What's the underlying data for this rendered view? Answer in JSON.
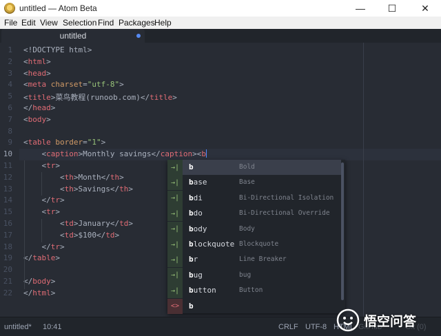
{
  "window": {
    "title": "untitled — Atom Beta",
    "controls": {
      "minimize": "—",
      "maximize": "☐",
      "close": "✕"
    }
  },
  "menu": [
    "File",
    "Edit",
    "View",
    "Selection",
    "Find",
    "Packages",
    "Help"
  ],
  "tab": {
    "label": "untitled",
    "modified": true
  },
  "editor": {
    "active_line": 10,
    "lines": [
      [
        {
          "t": "<!DOCTYPE html>",
          "c": "text"
        }
      ],
      [
        {
          "t": "<",
          "c": "punct"
        },
        {
          "t": "html",
          "c": "tag"
        },
        {
          "t": ">",
          "c": "punct"
        }
      ],
      [
        {
          "t": "<",
          "c": "punct"
        },
        {
          "t": "head",
          "c": "tag"
        },
        {
          "t": ">",
          "c": "punct"
        }
      ],
      [
        {
          "t": "<",
          "c": "punct"
        },
        {
          "t": "meta",
          "c": "tag"
        },
        {
          "t": " ",
          "c": "text"
        },
        {
          "t": "charset",
          "c": "attr"
        },
        {
          "t": "=",
          "c": "punct"
        },
        {
          "t": "\"utf-8\"",
          "c": "str"
        },
        {
          "t": ">",
          "c": "punct"
        }
      ],
      [
        {
          "t": "<",
          "c": "punct"
        },
        {
          "t": "title",
          "c": "tag"
        },
        {
          "t": ">菜鸟教程(runoob.com)</",
          "c": "text"
        },
        {
          "t": "title",
          "c": "tag"
        },
        {
          "t": ">",
          "c": "punct"
        }
      ],
      [
        {
          "t": "</",
          "c": "punct"
        },
        {
          "t": "head",
          "c": "tag"
        },
        {
          "t": ">",
          "c": "punct"
        }
      ],
      [
        {
          "t": "<",
          "c": "punct"
        },
        {
          "t": "body",
          "c": "tag"
        },
        {
          "t": ">",
          "c": "punct"
        }
      ],
      [],
      [
        {
          "t": "<",
          "c": "punct"
        },
        {
          "t": "table",
          "c": "tag"
        },
        {
          "t": " ",
          "c": "text"
        },
        {
          "t": "border",
          "c": "attr"
        },
        {
          "t": "=",
          "c": "punct"
        },
        {
          "t": "\"1\"",
          "c": "str"
        },
        {
          "t": ">",
          "c": "punct"
        }
      ],
      [
        {
          "t": "    <",
          "c": "punct"
        },
        {
          "t": "caption",
          "c": "tag"
        },
        {
          "t": ">Monthly savings</",
          "c": "text"
        },
        {
          "t": "caption",
          "c": "tag"
        },
        {
          "t": "><",
          "c": "punct"
        },
        {
          "t": "b",
          "c": "tag"
        }
      ],
      [
        {
          "t": "    <",
          "c": "punct"
        },
        {
          "t": "tr",
          "c": "tag"
        },
        {
          "t": ">",
          "c": "punct"
        }
      ],
      [
        {
          "t": "        <",
          "c": "punct"
        },
        {
          "t": "th",
          "c": "tag"
        },
        {
          "t": ">Month</",
          "c": "text"
        },
        {
          "t": "th",
          "c": "tag"
        },
        {
          "t": ">",
          "c": "punct"
        }
      ],
      [
        {
          "t": "        <",
          "c": "punct"
        },
        {
          "t": "th",
          "c": "tag"
        },
        {
          "t": ">Savings</",
          "c": "text"
        },
        {
          "t": "th",
          "c": "tag"
        },
        {
          "t": ">",
          "c": "punct"
        }
      ],
      [
        {
          "t": "    </",
          "c": "punct"
        },
        {
          "t": "tr",
          "c": "tag"
        },
        {
          "t": ">",
          "c": "punct"
        }
      ],
      [
        {
          "t": "    <",
          "c": "punct"
        },
        {
          "t": "tr",
          "c": "tag"
        },
        {
          "t": ">",
          "c": "punct"
        }
      ],
      [
        {
          "t": "        <",
          "c": "punct"
        },
        {
          "t": "td",
          "c": "tag"
        },
        {
          "t": ">January</",
          "c": "text"
        },
        {
          "t": "td",
          "c": "tag"
        },
        {
          "t": ">",
          "c": "punct"
        }
      ],
      [
        {
          "t": "        <",
          "c": "punct"
        },
        {
          "t": "td",
          "c": "tag"
        },
        {
          "t": ">$100</",
          "c": "text"
        },
        {
          "t": "td",
          "c": "tag"
        },
        {
          "t": ">",
          "c": "punct"
        }
      ],
      [
        {
          "t": "    </",
          "c": "punct"
        },
        {
          "t": "tr",
          "c": "tag"
        },
        {
          "t": ">",
          "c": "punct"
        }
      ],
      [
        {
          "t": "</",
          "c": "punct"
        },
        {
          "t": "table",
          "c": "tag"
        },
        {
          "t": ">",
          "c": "punct"
        }
      ],
      [],
      [
        {
          "t": "</",
          "c": "punct"
        },
        {
          "t": "body",
          "c": "tag"
        },
        {
          "t": ">",
          "c": "punct"
        }
      ],
      [
        {
          "t": "</",
          "c": "punct"
        },
        {
          "t": "html",
          "c": "tag"
        },
        {
          "t": ">",
          "c": "punct"
        }
      ]
    ]
  },
  "autocomplete": {
    "prefix": "b",
    "selected": 0,
    "items": [
      {
        "word": "b",
        "desc": "Bold",
        "kind": "tag"
      },
      {
        "word": "base",
        "desc": "Base",
        "kind": "tag"
      },
      {
        "word": "bdi",
        "desc": "Bi-Directional Isolation",
        "kind": "tag"
      },
      {
        "word": "bdo",
        "desc": "Bi-Directional Override",
        "kind": "tag"
      },
      {
        "word": "body",
        "desc": "Body",
        "kind": "tag"
      },
      {
        "word": "blockquote",
        "desc": "Blockquote",
        "kind": "tag"
      },
      {
        "word": "br",
        "desc": "Line Breaker",
        "kind": "tag"
      },
      {
        "word": "bug",
        "desc": "bug",
        "kind": "tag"
      },
      {
        "word": "button",
        "desc": "Button",
        "kind": "tag"
      },
      {
        "word": "b",
        "desc": "",
        "kind": "snippet"
      }
    ],
    "badges": {
      "tag": "→|",
      "snippet": "<>"
    }
  },
  "status": {
    "file": "untitled*",
    "cursor": "10:41",
    "line_ending": "CRLF",
    "encoding": "UTF-8",
    "grammar": "HTML",
    "github": "GitHub",
    "git": "Git (0)"
  },
  "watermark": {
    "text": "悟空问答"
  },
  "colors": {
    "accent": "#568af2",
    "tag": "#e06c75",
    "attr": "#d19a66",
    "string": "#98c379",
    "text": "#abb2bf"
  }
}
